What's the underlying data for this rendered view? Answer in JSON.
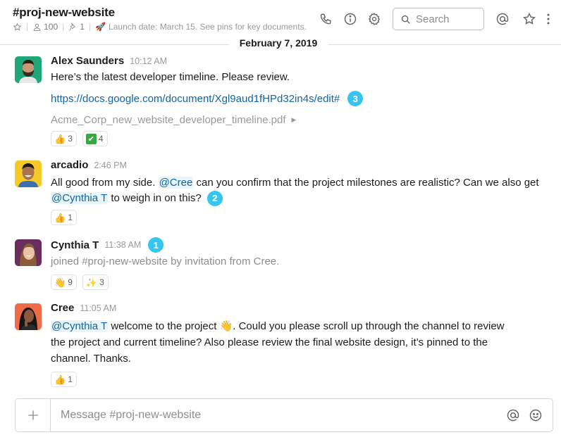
{
  "header": {
    "channel_name": "#proj-new-website",
    "member_count": "100",
    "pinned_count": "1",
    "topic_emoji": "🚀",
    "topic": "Launch date: March 15. See pins for key documents.",
    "search_placeholder": "Search",
    "icons": [
      "star-icon",
      "member-icon",
      "pin-icon",
      "phone-icon",
      "info-icon",
      "gear-icon",
      "search-icon",
      "at-icon",
      "star-icon",
      "more-vertical-icon"
    ]
  },
  "date_divider": "February 7, 2019",
  "messages": [
    {
      "author": "Alex Saunders",
      "time": "10:12 AM",
      "avatar_color": "#1fa67a",
      "text": "Here’s the latest developer timeline. Please review.",
      "link": "https://docs.google.com/document/Xgl9aud1fHPd32in4s/edit#",
      "badge": "3",
      "file": "Acme_Corp_new_website_developer_timeline.pdf",
      "reactions": [
        {
          "emoji": "👍",
          "count": "3"
        },
        {
          "emoji": "✔",
          "count": "4"
        }
      ]
    },
    {
      "author": "arcadio",
      "time": "2:46 PM",
      "avatar_color": "#f5c928",
      "text_1": "All good from my side. ",
      "mention_1": "@Cree",
      "text_2": " can you confirm that the project milestones are realistic? Can we also get ",
      "mention_2": "@Cynthia T",
      "text_3": " to weigh in on this? ",
      "badge": "2",
      "reactions": [
        {
          "emoji": "👍",
          "count": "1"
        }
      ]
    },
    {
      "author": "Cynthia T",
      "time": "11:38 AM",
      "avatar_color": "#6b2d5c",
      "badge": "1",
      "text": "joined #proj-new-website by invitation from Cree.",
      "reactions": [
        {
          "emoji": "👋",
          "count": "9"
        },
        {
          "emoji": "✨",
          "count": "3"
        }
      ]
    },
    {
      "author": "Cree",
      "time": "11:05 AM",
      "avatar_color": "#ef6c4a",
      "mention_1": "@Cynthia T",
      "text_1": " welcome to the project ",
      "emoji": "👋",
      "text_2": ". Could you please scroll up through the channel to review the project and current timeline? Also please review the final website design, it’s pinned to the channel. Thanks.",
      "reactions": [
        {
          "emoji": "👍",
          "count": "1"
        }
      ]
    }
  ],
  "composer": {
    "placeholder": "Message #proj-new-website"
  }
}
